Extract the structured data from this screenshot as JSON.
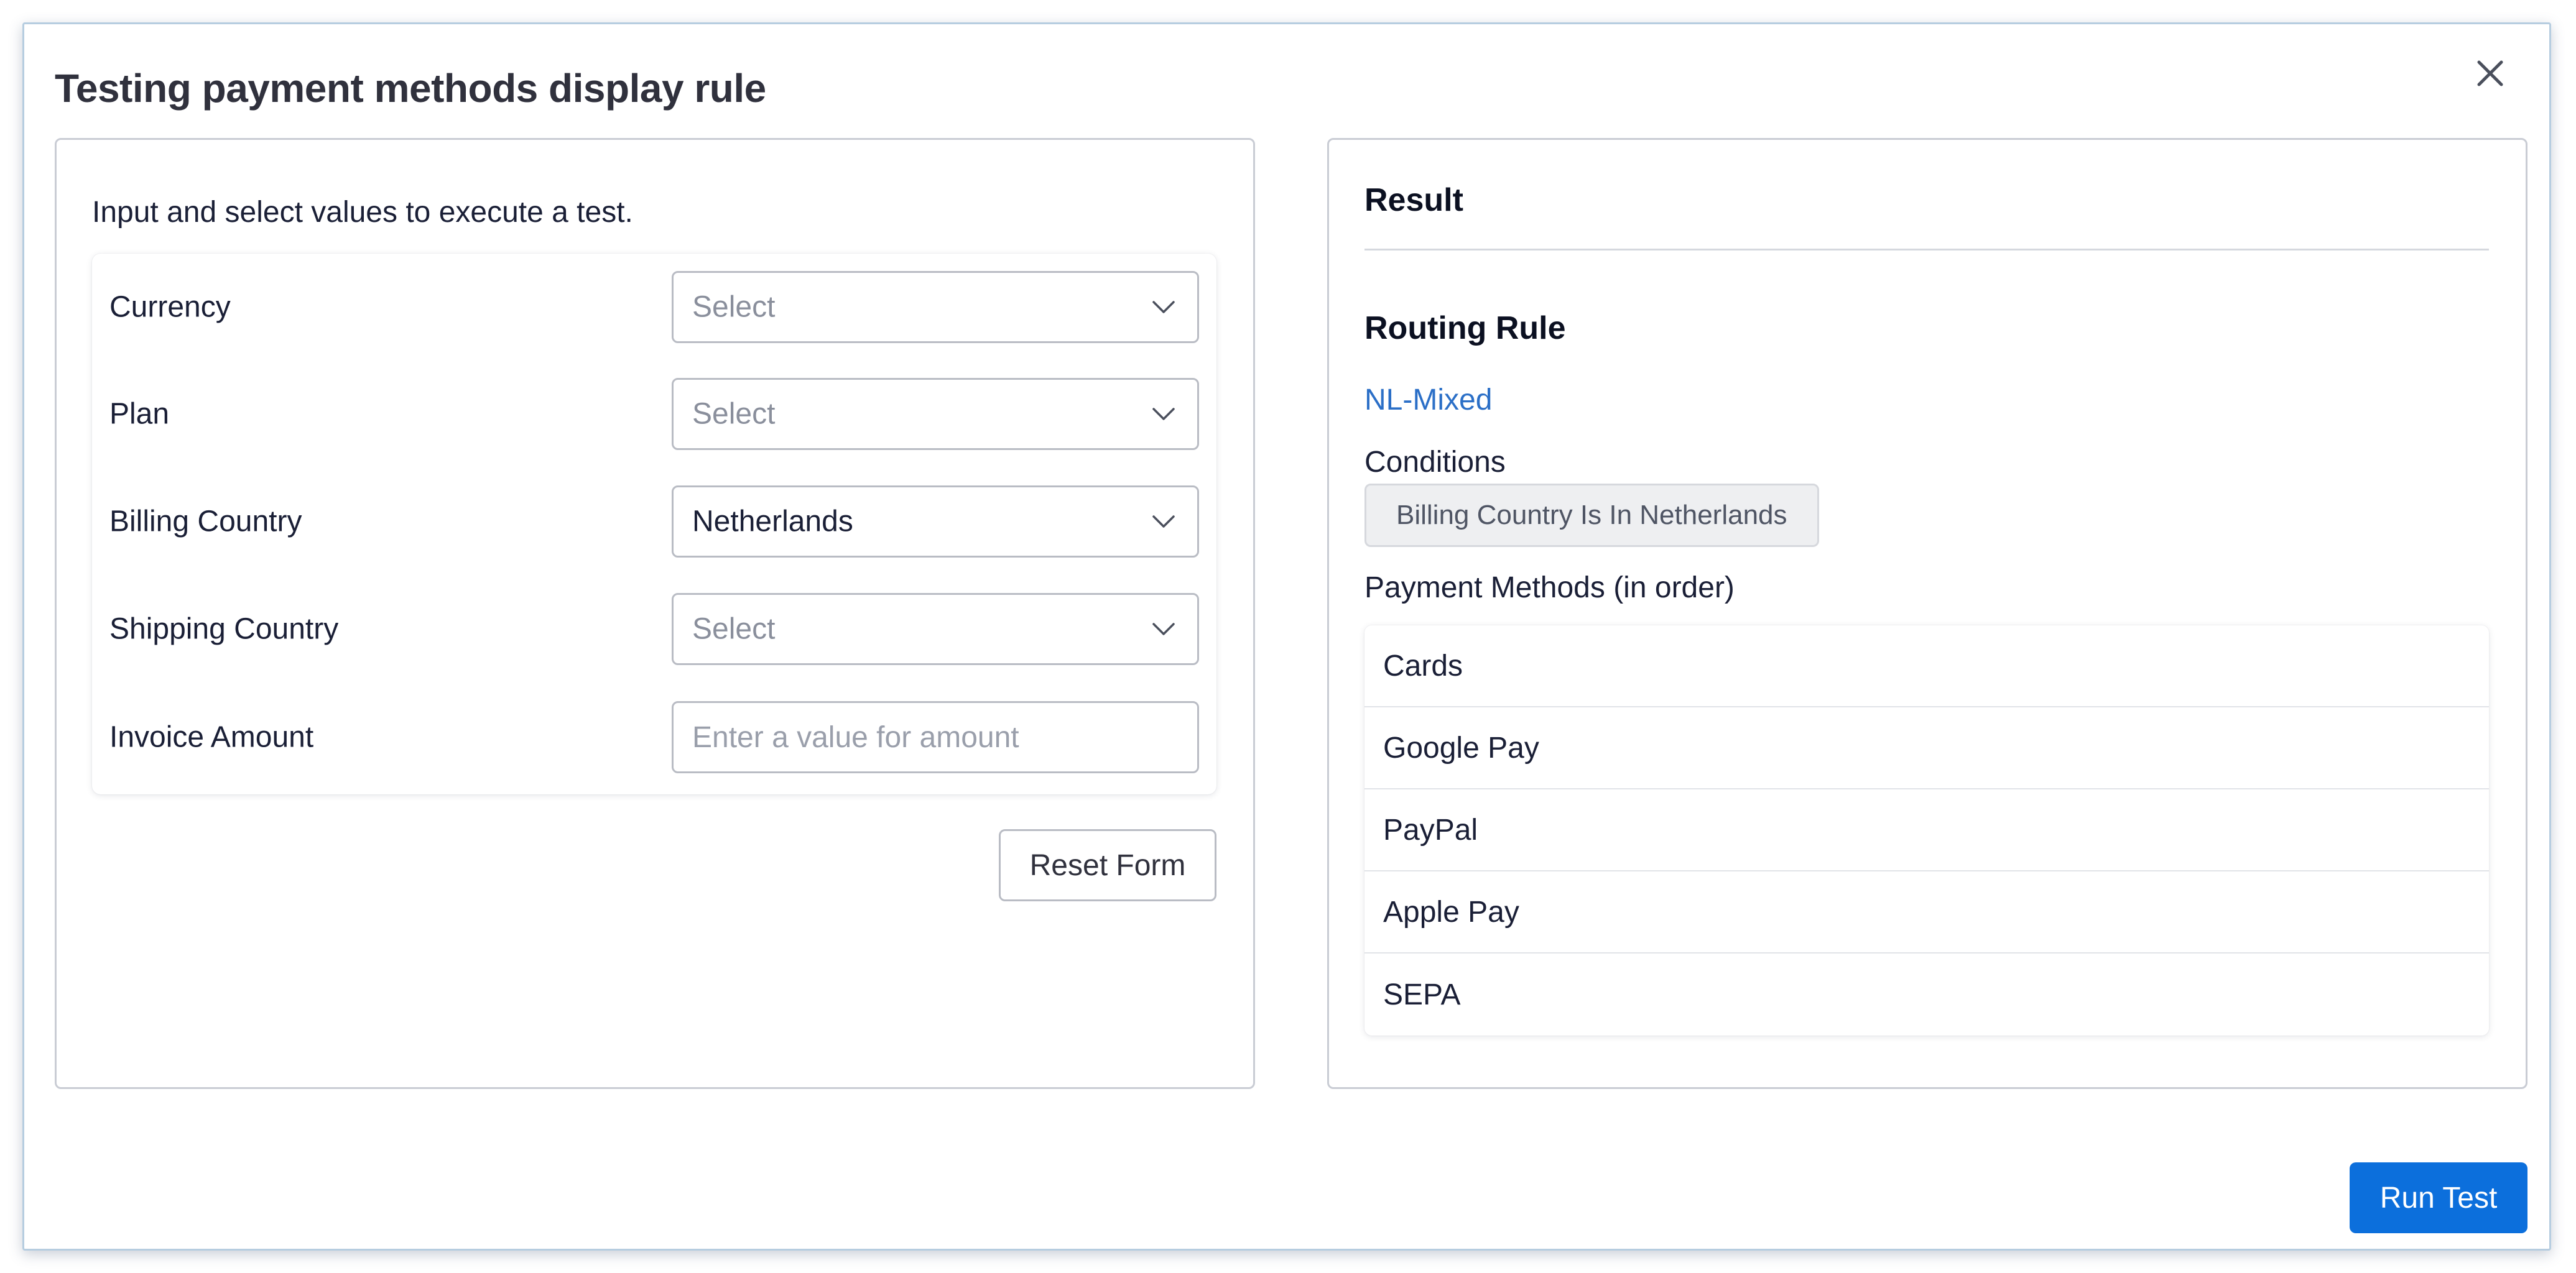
{
  "dialog": {
    "title": "Testing payment methods display rule",
    "close_icon": "close-icon"
  },
  "form": {
    "intro": "Input and select values to execute a test.",
    "fields": [
      {
        "label": "Currency",
        "value": "Select",
        "is_placeholder": true,
        "type": "select"
      },
      {
        "label": "Plan",
        "value": "Select",
        "is_placeholder": true,
        "type": "select"
      },
      {
        "label": "Billing Country",
        "value": "Netherlands",
        "is_placeholder": false,
        "type": "select"
      },
      {
        "label": "Shipping Country",
        "value": "Select",
        "is_placeholder": true,
        "type": "select"
      },
      {
        "label": "Invoice Amount",
        "value": "",
        "placeholder": "Enter a value for amount",
        "type": "text"
      }
    ],
    "reset_label": "Reset Form"
  },
  "result": {
    "title": "Result",
    "routing_rule_heading": "Routing Rule",
    "rule_name": "NL-Mixed",
    "conditions_label": "Conditions",
    "condition": "Billing Country Is In Netherlands",
    "payment_methods_label": "Payment Methods (in order)",
    "payment_methods": [
      "Cards",
      "Google Pay",
      "PayPal",
      "Apple Pay",
      "SEPA"
    ]
  },
  "actions": {
    "run_test_label": "Run Test"
  },
  "colors": {
    "primary": "#0c6fdc",
    "link": "#2b6fc7",
    "text": "#1a1f36",
    "placeholder": "#8a8f9c",
    "border": "#c9ccd4"
  }
}
